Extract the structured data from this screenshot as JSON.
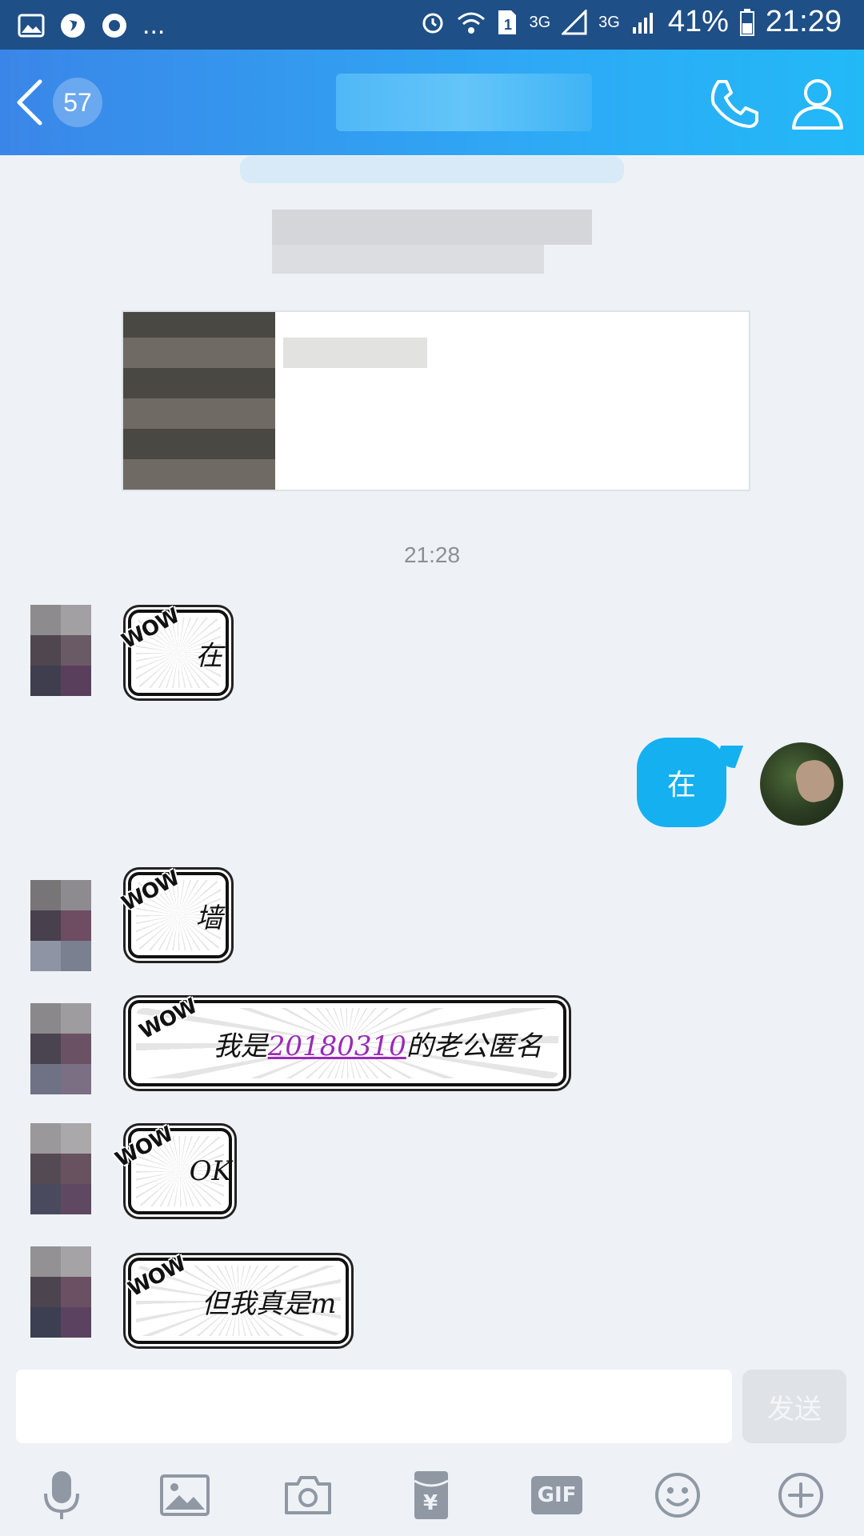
{
  "status_bar": {
    "left_more": "...",
    "network_1": "3G",
    "network_2": "3G",
    "battery_percent": "41%",
    "time": "21:29"
  },
  "header": {
    "unread_count": "57"
  },
  "timestamp": "21:28",
  "messages": [
    {
      "side": "left",
      "style": "comic",
      "badge": "WOW",
      "text": "在"
    },
    {
      "side": "right",
      "style": "plain",
      "text": "在"
    },
    {
      "side": "left",
      "style": "comic",
      "badge": "WOW",
      "text": "墙"
    },
    {
      "side": "left",
      "style": "comic",
      "badge": "WOW",
      "text_before": "我是",
      "link_text": "20180310",
      "text_after": "的老公匿名"
    },
    {
      "side": "left",
      "style": "comic",
      "badge": "WOW",
      "text": "OK"
    },
    {
      "side": "left",
      "style": "comic",
      "badge": "WOW",
      "text": "但我真是m"
    }
  ],
  "input": {
    "value": "",
    "send_label": "发送"
  },
  "toolbar": {
    "gif_label": "GIF",
    "icons": [
      "microphone-icon",
      "image-icon",
      "camera-icon",
      "red-packet-icon",
      "gif-icon",
      "emoji-icon",
      "plus-icon"
    ]
  },
  "colors": {
    "header_start": "#3a86e8",
    "header_end": "#22b9f7",
    "my_bubble": "#15b0f0",
    "link": "#9a2bb7",
    "background": "#eef2f7"
  }
}
